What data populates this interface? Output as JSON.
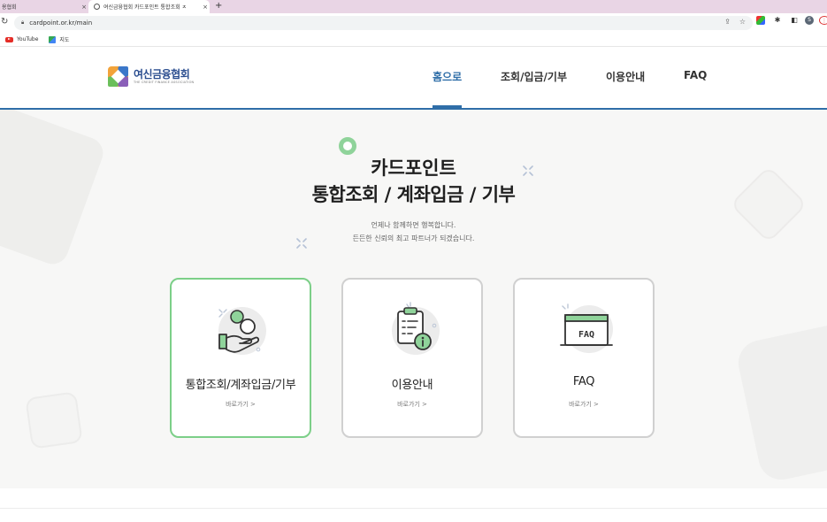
{
  "browser": {
    "tabs": [
      {
        "title": "용협회",
        "active": false
      },
      {
        "title": "여신금융협회 카드포인트 통합조회 ㅈ",
        "active": true
      }
    ],
    "tab_close": "×",
    "new_tab": "+",
    "url": "cardpoint.or.kr/main",
    "bookmarks": [
      {
        "label": "YouTube",
        "icon": "youtube-icon"
      },
      {
        "label": "지도",
        "icon": "maps-icon"
      }
    ],
    "profile_initial": "S"
  },
  "site": {
    "logo_name": "여신금융협회",
    "logo_sub": "THE CREDIT FINANCE ASSOCIATION",
    "nav": [
      {
        "label": "홈으로",
        "active": true
      },
      {
        "label": "조회/입금/기부",
        "active": false
      },
      {
        "label": "이용안내",
        "active": false
      },
      {
        "label": "FAQ",
        "active": false
      }
    ],
    "accent": "#2f6ea8"
  },
  "hero": {
    "title_line1": "카드포인트",
    "title_line2": "통합조회 / 계좌입금 / 기부",
    "subtitle_line1": "언제나 함께하면 행복합니다.",
    "subtitle_line2": "든든한 신뢰의 최고 파트너가 되겠습니다."
  },
  "cards": [
    {
      "title": "통합조회/계좌입금/기부",
      "link": "바로가기 >",
      "icon": "hand-coin-icon",
      "highlighted": true
    },
    {
      "title": "이용안내",
      "link": "바로가기 >",
      "icon": "clipboard-info-icon",
      "highlighted": false
    },
    {
      "title": "FAQ",
      "link": "바로가기 >",
      "icon": "faq-window-icon",
      "highlighted": false
    }
  ],
  "colors": {
    "highlight_border": "#7ccf88",
    "card_border": "#d0d0d0",
    "hero_bg": "#f7f7f6"
  }
}
